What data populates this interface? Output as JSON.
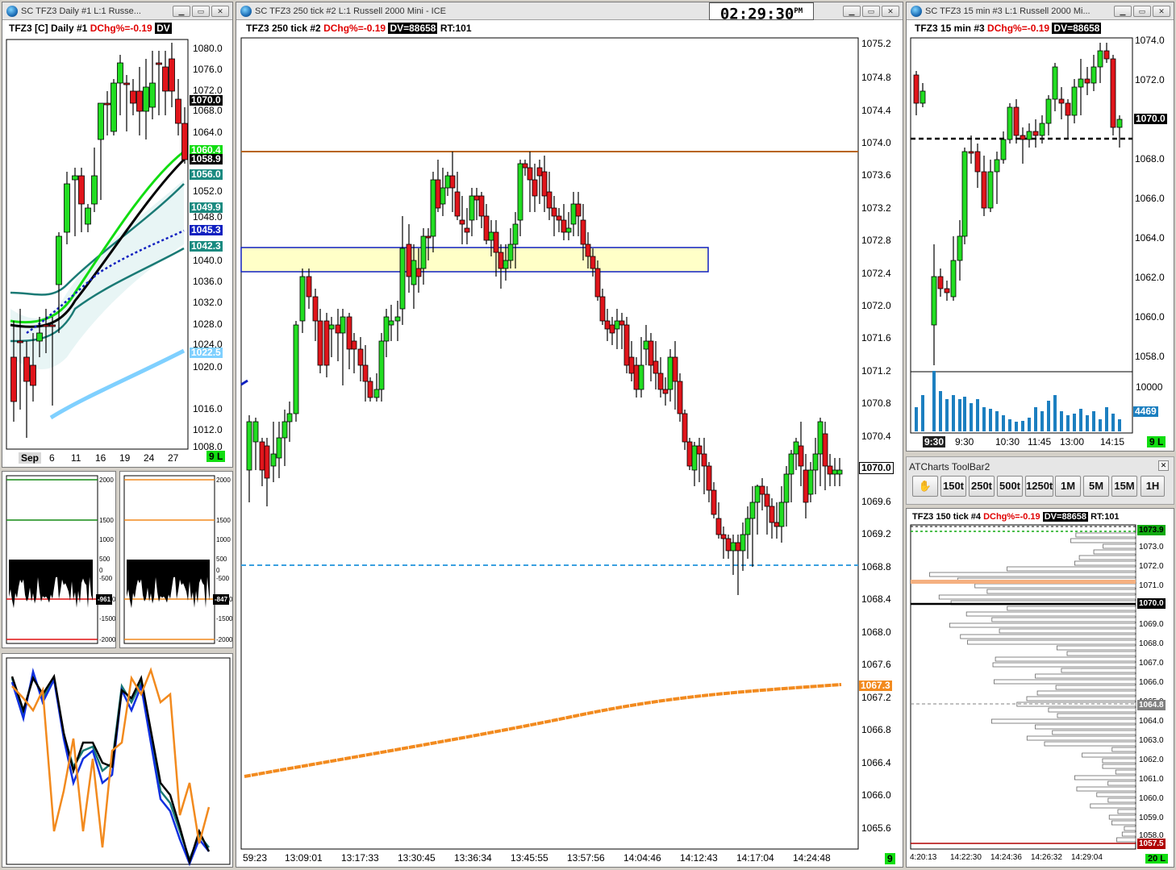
{
  "clock": "02:29:30",
  "clock_ampm": "PM",
  "daily": {
    "window_title": "SC TFZ3  Daily  #1  L:1  Russe...",
    "chart_label": "TFZ3 [C]  Daily  #1",
    "dchg": "DChg%=-0.19",
    "dv": "DV",
    "price_axis": [
      "1080.0",
      "1076.0",
      "1072.0",
      "1068.0",
      "1064.0",
      "1052.0",
      "1048.0",
      "1040.0",
      "1036.0",
      "1032.0",
      "1028.0",
      "1024.0",
      "1020.0",
      "1016.0",
      "1012.0",
      "1008.0"
    ],
    "tags": [
      {
        "text": "1070.0",
        "bg": "#000000",
        "fg": "#ffffff"
      },
      {
        "text": "1060.4",
        "bg": "#11dd11",
        "fg": "#ffffff"
      },
      {
        "text": "1058.9",
        "bg": "#000000",
        "fg": "#ffffff"
      },
      {
        "text": "1056.0",
        "bg": "#1a8a80",
        "fg": "#ffffff"
      },
      {
        "text": "1049.9",
        "bg": "#1a8a80",
        "fg": "#ffffff"
      },
      {
        "text": "1045.3",
        "bg": "#1020c0",
        "fg": "#ffffff"
      },
      {
        "text": "1042.3",
        "bg": "#1a8a80",
        "fg": "#ffffff"
      },
      {
        "text": "1022.5",
        "bg": "#7fd0ff",
        "fg": "#ffffff"
      }
    ],
    "time_axis": [
      "Sep",
      "6",
      "11",
      "16",
      "19",
      "24",
      "27"
    ],
    "status": "9 L"
  },
  "tick250": {
    "window_title": "SC TFZ3  250 tick  #2  L:1  Russell 2000 Mini - ICE",
    "chart_label": "TFZ3  250 tick  #2",
    "dchg": "DChg%=-0.19",
    "dv": "DV=88658",
    "rt": "RT:101",
    "price_axis": [
      "1075.2",
      "1074.8",
      "1074.4",
      "1074.0",
      "1073.6",
      "1073.2",
      "1072.8",
      "1072.4",
      "1072.0",
      "1071.6",
      "1071.2",
      "1070.8",
      "1070.4",
      "1070.0",
      "1069.6",
      "1069.2",
      "1068.8",
      "1068.4",
      "1068.0",
      "1067.6",
      "1067.2",
      "1066.8",
      "1066.4",
      "1066.0",
      "1065.6"
    ],
    "current_tag": "1070.0",
    "orange_tag": "1067.3",
    "time_axis": [
      "59:23",
      "13:09:01",
      "13:17:33",
      "13:30:45",
      "13:36:34",
      "13:45:55",
      "13:57:56",
      "14:04:46",
      "14:12:43",
      "14:17:04",
      "14:24:48"
    ],
    "status": "9"
  },
  "min15": {
    "window_title": "SC TFZ3  15 min  #3  L:1  Russell 2000 Mi...",
    "chart_label": "TFZ3  15 min  #3",
    "dchg": "DChg%=-0.19",
    "dv": "DV=88658",
    "price_axis": [
      "1074.0",
      "1072.0",
      "1070.0",
      "1068.0",
      "1066.0",
      "1064.0",
      "1062.0",
      "1060.0",
      "1058.0"
    ],
    "current_tag": "1070.0",
    "volume_axis": "10000",
    "volume_tag": "4469",
    "time_axis": [
      "9:30",
      "9:30",
      "10:30",
      "11:45",
      "13:00",
      "14:15"
    ],
    "status": "9 L"
  },
  "toolbar": {
    "title": "ATCharts ToolBar2",
    "buttons": [
      "150t",
      "250t",
      "500t",
      "1250t",
      "1M",
      "5M",
      "15M",
      "1H"
    ]
  },
  "tick150": {
    "chart_label": "TFZ3  150 tick  #4",
    "dchg": "DChg%=-0.19",
    "dv": "DV=88658",
    "rt": "RT:101",
    "price_axis": [
      "1073.0",
      "1072.0",
      "1071.0",
      "1070.0",
      "1069.0",
      "1068.0",
      "1067.0",
      "1066.0",
      "1065.0",
      "1064.0",
      "1063.0",
      "1062.0",
      "1061.0",
      "1060.0",
      "1059.0",
      "1058.0"
    ],
    "tags": [
      {
        "text": "1073.9",
        "bg": "#11aa11",
        "fg": "#000000"
      },
      {
        "text": "1070.0",
        "bg": "#000000",
        "fg": "#ffffff"
      },
      {
        "text": "1064.8",
        "bg": "#808080",
        "fg": "#ffffff"
      },
      {
        "text": "1057.5",
        "bg": "#b00000",
        "fg": "#ffffff"
      }
    ],
    "time_axis": [
      "4:20:13",
      "14:22:30",
      "14:24:36",
      "14:26:32",
      "14:29:04"
    ],
    "status": "20 L"
  },
  "ind1": {
    "axis": [
      "2000",
      "1500",
      "1000",
      "500",
      "0",
      "-500",
      "-1000",
      "-1500",
      "-2000"
    ],
    "tags": [
      {
        "text": "-961",
        "bg": "#000000",
        "fg": "#ffffff"
      }
    ]
  },
  "ind2": {
    "axis": [
      "2000",
      "1500",
      "1000",
      "500",
      "0",
      "-500",
      "-1000",
      "-1500",
      "-2000"
    ],
    "tags": [
      {
        "text": "-847",
        "bg": "#000000",
        "fg": "#ffffff"
      }
    ]
  }
}
